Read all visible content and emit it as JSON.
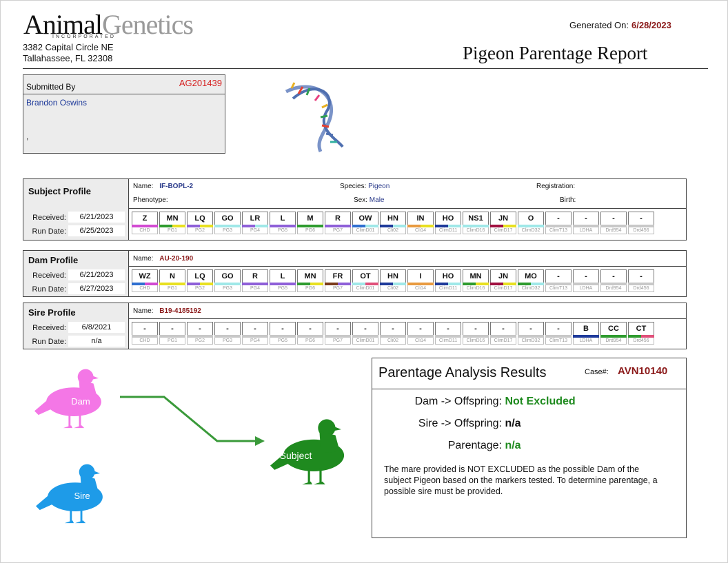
{
  "company": {
    "name_part1": "Animal",
    "name_part2": "Genetics",
    "name_sub": "INCORPORATED",
    "address_line1": "3382 Capital Circle NE",
    "address_line2": "Tallahassee, FL 32308"
  },
  "report": {
    "generated_label": "Generated On:",
    "generated_date": "6/28/2023",
    "title": "Pigeon Parentage Report"
  },
  "submitted": {
    "label": "Submitted By",
    "id": "AG201439",
    "name": "Brandon Oswins",
    "extra": ","
  },
  "subject": {
    "title": "Subject Profile",
    "received_label": "Received:",
    "received": "6/21/2023",
    "run_label": "Run Date:",
    "run_date": "6/25/2023",
    "name_label": "Name:",
    "name": "IF-BOPL-2",
    "species_label": "Species:",
    "species": "Pigeon",
    "registration_label": "Registration:",
    "phenotype_label": "Phenotype:",
    "sex_label": "Sex:",
    "sex": "Male",
    "birth_label": "Birth:",
    "alleles": [
      "Z",
      "MN",
      "LQ",
      "GO",
      "LR",
      "L",
      "M",
      "R",
      "OW",
      "HN",
      "IN",
      "HO",
      "NS1",
      "JN",
      "O",
      "-",
      "-",
      "-",
      "-"
    ]
  },
  "dam": {
    "title": "Dam Profile",
    "received_label": "Received:",
    "received": "6/21/2023",
    "run_label": "Run Date:",
    "run_date": "6/27/2023",
    "name_label": "Name:",
    "name": "AU-20-190",
    "alleles": [
      "WZ",
      "N",
      "LQ",
      "GO",
      "R",
      "L",
      "MN",
      "FR",
      "OT",
      "HN",
      "I",
      "HO",
      "MN",
      "JN",
      "MO",
      "-",
      "-",
      "-",
      "-"
    ]
  },
  "sire": {
    "title": "Sire Profile",
    "received_label": "Received:",
    "received": "6/8/2021",
    "run_label": "Run Date:",
    "run_date": "n/a",
    "name_label": "Name:",
    "name": "B19-4185192",
    "alleles": [
      "-",
      "-",
      "-",
      "-",
      "-",
      "-",
      "-",
      "-",
      "-",
      "-",
      "-",
      "-",
      "-",
      "-",
      "-",
      "-",
      "B",
      "CC",
      "CT"
    ]
  },
  "markers": [
    "CHD",
    "PG1",
    "PG2",
    "PG3",
    "PG4",
    "PG5",
    "PG6",
    "PG7",
    "ClimD01",
    "Cli02",
    "Cli14",
    "ClimD11",
    "ClimD16",
    "ClimD17",
    "ClimD32",
    "ClimT13",
    "LDHA",
    "Drd954",
    "Drd456"
  ],
  "subject_colors": [
    [
      "#d24ad2",
      "#d24ad2"
    ],
    [
      "#2e9b2e",
      "#e8e020"
    ],
    [
      "#8e5fd8",
      "#e8e020"
    ],
    [
      "#9fe8e8",
      "#9fe8e8"
    ],
    [
      "#8e5fd8",
      "#9fe8e8"
    ],
    [
      "#8e5fd8",
      "#8e5fd8"
    ],
    [
      "#2e9b2e",
      "#2e9b2e"
    ],
    [
      "#8e5fd8",
      "#8e5fd8"
    ],
    [
      "#2e6fd0",
      "#9fe8e8"
    ],
    [
      "#1e3a9a",
      "#9fe8e8"
    ],
    [
      "#e89a40",
      "#e8e020"
    ],
    [
      "#1e3a9a",
      "#9fe8e8"
    ],
    [
      "#9fe8e8",
      "#9fe8e8"
    ],
    [
      "#a01040",
      "#e8e020"
    ],
    [
      "#9fe8e8",
      "#9fe8e8"
    ],
    [
      "#c8c8c8",
      "#c8c8c8"
    ],
    [
      "#c8c8c8",
      "#c8c8c8"
    ],
    [
      "#c8c8c8",
      "#c8c8c8"
    ],
    [
      "#c8c8c8",
      "#c8c8c8"
    ]
  ],
  "dam_colors": [
    [
      "#2e6fd0",
      "#d24ad2"
    ],
    [
      "#e8e020",
      "#e8e020"
    ],
    [
      "#8e5fd8",
      "#e8e020"
    ],
    [
      "#9fe8e8",
      "#9fe8e8"
    ],
    [
      "#8e5fd8",
      "#8e5fd8"
    ],
    [
      "#8e5fd8",
      "#8e5fd8"
    ],
    [
      "#2e9b2e",
      "#e8e020"
    ],
    [
      "#7a3a1a",
      "#8e5fd8"
    ],
    [
      "#9fe8e8",
      "#e0507a"
    ],
    [
      "#1e3a9a",
      "#9fe8e8"
    ],
    [
      "#e89a40",
      "#e89a40"
    ],
    [
      "#1e3a9a",
      "#9fe8e8"
    ],
    [
      "#2e9b2e",
      "#e8e020"
    ],
    [
      "#a01040",
      "#e8e020"
    ],
    [
      "#2e9b2e",
      "#9fe8e8"
    ],
    [
      "#c8c8c8",
      "#c8c8c8"
    ],
    [
      "#c8c8c8",
      "#c8c8c8"
    ],
    [
      "#c8c8c8",
      "#c8c8c8"
    ],
    [
      "#c8c8c8",
      "#c8c8c8"
    ]
  ],
  "sire_colors": [
    [
      "#c8c8c8",
      "#c8c8c8"
    ],
    [
      "#c8c8c8",
      "#c8c8c8"
    ],
    [
      "#c8c8c8",
      "#c8c8c8"
    ],
    [
      "#c8c8c8",
      "#c8c8c8"
    ],
    [
      "#c8c8c8",
      "#c8c8c8"
    ],
    [
      "#c8c8c8",
      "#c8c8c8"
    ],
    [
      "#c8c8c8",
      "#c8c8c8"
    ],
    [
      "#c8c8c8",
      "#c8c8c8"
    ],
    [
      "#c8c8c8",
      "#c8c8c8"
    ],
    [
      "#c8c8c8",
      "#c8c8c8"
    ],
    [
      "#c8c8c8",
      "#c8c8c8"
    ],
    [
      "#c8c8c8",
      "#c8c8c8"
    ],
    [
      "#c8c8c8",
      "#c8c8c8"
    ],
    [
      "#c8c8c8",
      "#c8c8c8"
    ],
    [
      "#c8c8c8",
      "#c8c8c8"
    ],
    [
      "#c8c8c8",
      "#c8c8c8"
    ],
    [
      "#1e3a9a",
      "#1e3a9a"
    ],
    [
      "#2e9b2e",
      "#2e9b2e"
    ],
    [
      "#2e9b2e",
      "#e0507a"
    ]
  ],
  "diagram": {
    "dam_label": "Dam",
    "sire_label": "Sire",
    "subject_label": "Subject",
    "dam_color": "#f477e6",
    "sire_color": "#1e9be8",
    "subject_color": "#1f8a1f",
    "arrow_color": "#3a9a3a"
  },
  "results": {
    "title": "Parentage Analysis Results",
    "case_label": "Case#:",
    "case_id": "AVN10140",
    "dam_label": "Dam -> Offspring:",
    "dam_value": "Not Excluded",
    "sire_label": "Sire -> Offspring:",
    "sire_value": "n/a",
    "parentage_label": "Parentage:",
    "parentage_value": "n/a",
    "text": "The mare provided is NOT EXCLUDED as the possible Dam of the subject Pigeon based on the markers tested.  To determine parentage, a possible sire must be provided."
  }
}
